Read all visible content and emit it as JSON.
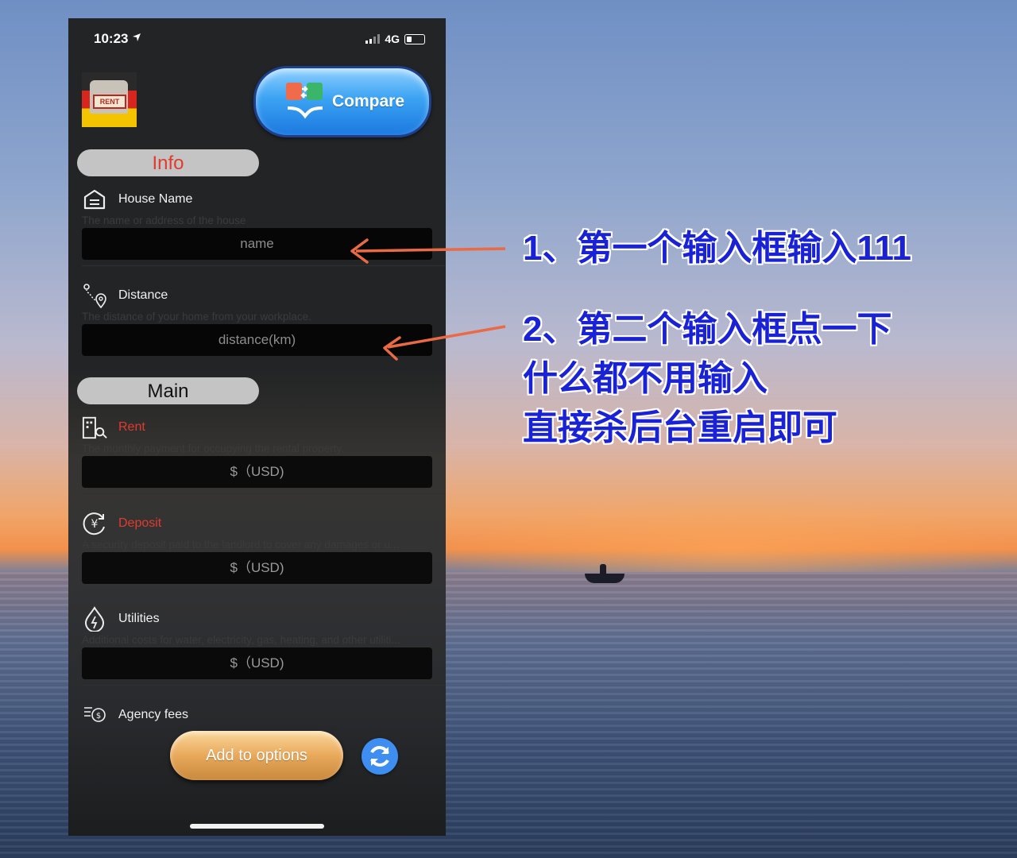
{
  "status_bar": {
    "time": "10:23",
    "network": "4G"
  },
  "header": {
    "compare_label": "Compare"
  },
  "sections": {
    "info_label": "Info",
    "main_label": "Main"
  },
  "fields": [
    {
      "label": "House Name",
      "description": "The name or address of the house",
      "placeholder": "name",
      "label_color": "#f1f1f1"
    },
    {
      "label": "Distance",
      "description": "The distance of your home from your workplace.",
      "placeholder": "distance(km)",
      "label_color": "#f1f1f1"
    },
    {
      "label": "Rent",
      "description": "The monthly payment for occupying the rental property.",
      "placeholder": "$（USD)",
      "label_color": "#e23b2e"
    },
    {
      "label": "Deposit",
      "description": "A security deposit paid to the landlord to cover any damages or u...",
      "placeholder": "$（USD)",
      "label_color": "#e23b2e"
    },
    {
      "label": "Utilities",
      "description": "Additional costs for water, electricity, gas, heating, and other utiliti...",
      "placeholder": "$（USD)",
      "label_color": "#f1f1f1"
    },
    {
      "label": "Agency fees"
    }
  ],
  "footer": {
    "add_label": "Add to options"
  },
  "annotations": {
    "note1": "1、第一个输入框输入111",
    "note2_lines": [
      "2、第二个输入框点一下",
      "什么都不用输入",
      "直接杀后台重启即可"
    ],
    "arrow_color": "#ea6a45",
    "text_color": "#1a22d6"
  },
  "colors": {
    "accent_red": "#e23b2e",
    "compare_blue": "#2f8ff0",
    "add_gold": "#e9a95c"
  }
}
